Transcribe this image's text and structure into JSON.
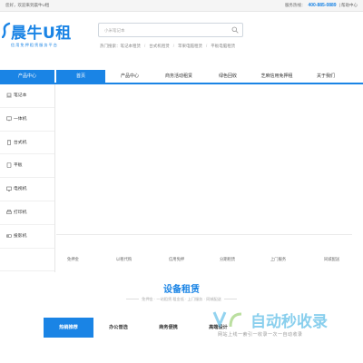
{
  "topbar": {
    "greeting": "您好，欢迎来到晨牛U租",
    "hotline_label": "服务热线：",
    "phone": "400-885-0889",
    "help_label": "帮助中心"
  },
  "logo": {
    "name": "晨牛U租",
    "slogan": "信用免押租赁服务平台"
  },
  "search": {
    "placeholder": "小米笔记本",
    "value": ""
  },
  "hot": {
    "label": "热门搜索：",
    "items": [
      "笔记本租赁",
      "台式机租赁",
      "苹果电脑租赁",
      "平板电脑租赁"
    ]
  },
  "nav": {
    "category_label": "产品中心",
    "items": [
      "首页",
      "产品中心",
      "商务活动租赁",
      "绿色回收",
      "芝麻信用免押租",
      "关于我们"
    ],
    "active_index": 0
  },
  "sidebar": {
    "items": [
      {
        "label": "笔记本",
        "icon": "laptop-icon"
      },
      {
        "label": "一体机",
        "icon": "all-in-one-icon"
      },
      {
        "label": "台式机",
        "icon": "desktop-icon"
      },
      {
        "label": "平板",
        "icon": "tablet-icon"
      },
      {
        "label": "电视机",
        "icon": "tv-icon"
      },
      {
        "label": "打印机",
        "icon": "printer-icon"
      },
      {
        "label": "投影机",
        "icon": "projector-icon"
      },
      {
        "label": "",
        "icon": ""
      }
    ]
  },
  "features": [
    "免押金",
    "以租代购",
    "信用免押",
    "分期租赁",
    "上门服务",
    "同城配送"
  ],
  "rent": {
    "title": "设备租赁",
    "subtitle": "免押金 · 一站租赁 租金低 · 上门服务 · 同城配送",
    "tabs": [
      "热销推荐",
      "办公普选",
      "商务便携",
      "高端设计"
    ],
    "active_index": 0
  },
  "watermark": {
    "title": "自动秒收录",
    "subtitle": "网站上线一索引一收录一次一自动收录"
  },
  "colors": {
    "brand": "#1a84e5",
    "topbar_bg": "#f5f5f5"
  }
}
